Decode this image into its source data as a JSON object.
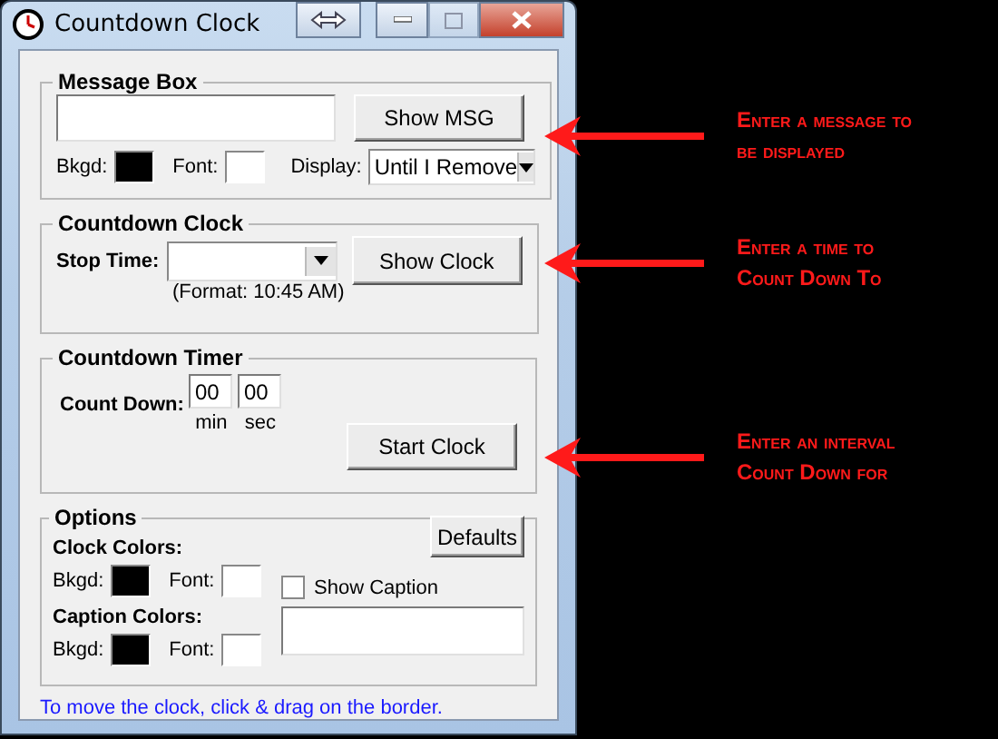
{
  "window": {
    "title": "Countdown Clock"
  },
  "message_box": {
    "title": "Message Box",
    "show_button": "Show MSG",
    "swatches": [
      {
        "label": "Bkgd:",
        "color": "#000000"
      },
      {
        "label": "Font:",
        "color": "#ffffff"
      }
    ],
    "display_label": "Display:",
    "display_value": "Until I Remove"
  },
  "countdown_clock": {
    "title": "Countdown Clock",
    "stop_time_label": "Stop Time:",
    "format_hint": "(Format: 10:45 AM)",
    "button": "Show Clock"
  },
  "countdown_timer": {
    "title": "Countdown Timer",
    "label": "Count Down:",
    "minutes": "00",
    "seconds": "00",
    "min_label": "min",
    "sec_label": "sec",
    "button": "Start Clock"
  },
  "options": {
    "title": "Options",
    "defaults_button": "Defaults",
    "clock_colors": {
      "label": "Clock Colors:",
      "swatches": [
        {
          "label": "Bkgd:",
          "color": "#000000"
        },
        {
          "label": "Font:",
          "color": "#ffffff"
        }
      ]
    },
    "caption_colors": {
      "label": "Caption Colors:",
      "swatches": [
        {
          "label": "Bkgd:",
          "color": "#000000"
        },
        {
          "label": "Font:",
          "color": "#ffffff"
        }
      ]
    },
    "show_caption": {
      "label": "Show Caption",
      "checked": false
    }
  },
  "footer": "To move the clock, click & drag on the border.",
  "annotations": [
    {
      "text": "Enter a message to\nbe displayed"
    },
    {
      "text": "Enter a time to\nCount Down To"
    },
    {
      "text": "Enter an interval\nCount Down for"
    }
  ]
}
